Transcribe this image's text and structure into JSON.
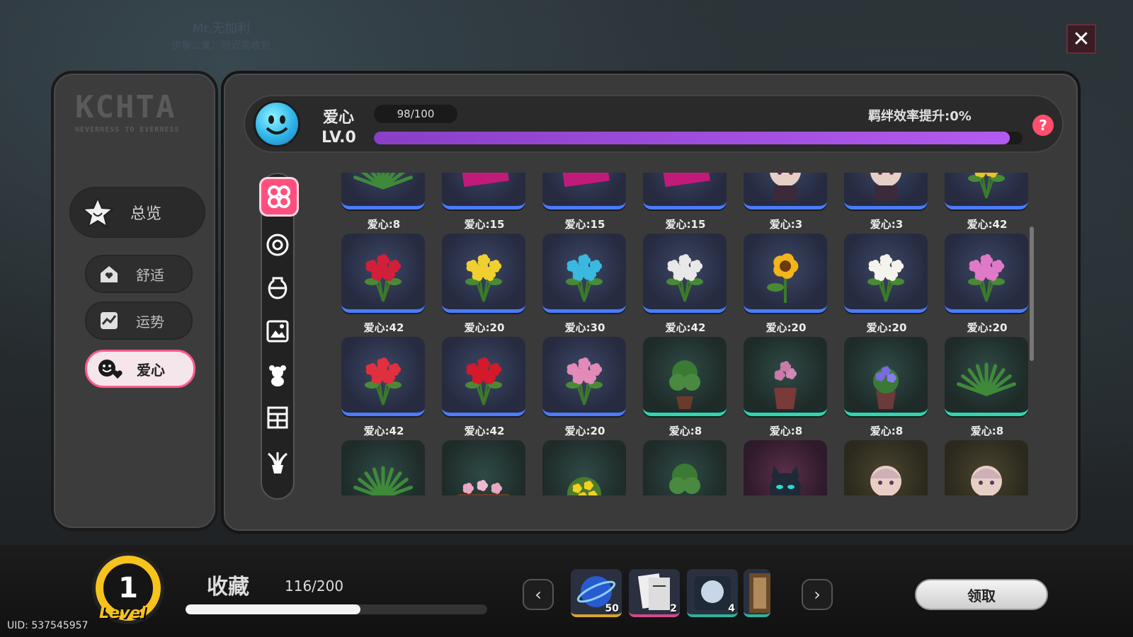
{
  "background": {
    "text1": "Mr.无加利",
    "text2": "伊鲁公寓）附近家收到"
  },
  "close": {
    "icon": "close-x-icon",
    "symbol": "✕"
  },
  "left_panel": {
    "logo_big": "KCHTA",
    "logo_small": "NEVERNESS TO EVERNESS",
    "nav": [
      {
        "label": "总览",
        "icon": "star-icon"
      },
      {
        "label": "舒适",
        "icon": "house-heart-icon"
      },
      {
        "label": "运势",
        "icon": "trend-chart-icon"
      },
      {
        "label": "爱心",
        "icon": "smiley-heart-icon"
      }
    ]
  },
  "header": {
    "title": "爱心",
    "level": "LV.0",
    "count": "98/100",
    "progress": 0.98,
    "efficiency": "羁绊效率提升:0%",
    "help_symbol": "?"
  },
  "categories": [
    {
      "name": "all-category-icon",
      "active": true
    },
    {
      "name": "disc-category-icon",
      "active": false
    },
    {
      "name": "vase-category-icon",
      "active": false
    },
    {
      "name": "picture-category-icon",
      "active": false
    },
    {
      "name": "teddy-bear-category-icon",
      "active": false
    },
    {
      "name": "shelf-category-icon",
      "active": false
    },
    {
      "name": "plant-category-icon",
      "active": false
    }
  ],
  "items": [
    {
      "cost": "爱心:8",
      "kind": "palm",
      "frame": "blue"
    },
    {
      "cost": "爱心:15",
      "kind": "poster",
      "frame": "blue"
    },
    {
      "cost": "爱心:15",
      "kind": "poster",
      "frame": "blue"
    },
    {
      "cost": "爱心:15",
      "kind": "poster",
      "frame": "blue"
    },
    {
      "cost": "爱心:3",
      "kind": "doll",
      "frame": "blue"
    },
    {
      "cost": "爱心:3",
      "kind": "doll",
      "frame": "blue"
    },
    {
      "cost": "爱心:42",
      "kind": "yellowrose",
      "frame": "blue"
    },
    {
      "cost": "爱心:42",
      "kind": "redrose",
      "frame": "blue"
    },
    {
      "cost": "爱心:20",
      "kind": "yellowtulip",
      "frame": "blue"
    },
    {
      "cost": "爱心:30",
      "kind": "bluerose",
      "frame": "blue"
    },
    {
      "cost": "爱心:42",
      "kind": "whiterose",
      "frame": "blue"
    },
    {
      "cost": "爱心:20",
      "kind": "sunflower",
      "frame": "blue"
    },
    {
      "cost": "爱心:20",
      "kind": "whitelily",
      "frame": "blue"
    },
    {
      "cost": "爱心:20",
      "kind": "pinklily",
      "frame": "blue"
    },
    {
      "cost": "爱心:42",
      "kind": "redlily",
      "frame": "blue"
    },
    {
      "cost": "爱心:42",
      "kind": "redtulip",
      "frame": "blue"
    },
    {
      "cost": "爱心:20",
      "kind": "pinktulip",
      "frame": "blue"
    },
    {
      "cost": "爱心:8",
      "kind": "pottree",
      "frame": "green"
    },
    {
      "cost": "爱心:8",
      "kind": "potpink",
      "frame": "green"
    },
    {
      "cost": "爱心:8",
      "kind": "potpurple",
      "frame": "green"
    },
    {
      "cost": "爱心:8",
      "kind": "fern",
      "frame": "green"
    },
    {
      "cost": "",
      "kind": "palm",
      "frame": "green"
    },
    {
      "cost": "",
      "kind": "planter",
      "frame": "green"
    },
    {
      "cost": "",
      "kind": "yellowbush",
      "frame": "green"
    },
    {
      "cost": "",
      "kind": "pottree",
      "frame": "green"
    },
    {
      "cost": "",
      "kind": "catdoll",
      "frame": "pink"
    },
    {
      "cost": "",
      "kind": "doll",
      "frame": "yellow"
    },
    {
      "cost": "",
      "kind": "doll",
      "frame": "yellow"
    }
  ],
  "bottom": {
    "level_value": "1",
    "level_word": "Level",
    "uid": "UID:  537545957",
    "collect_label": "收藏",
    "collect_count": "116/200",
    "collect_progress": 0.58,
    "prev_symbol": "‹",
    "next_symbol": "›",
    "rewards": [
      {
        "qty": "50",
        "icon": "orb-reward-icon",
        "color": "#d9a52a"
      },
      {
        "qty": "2",
        "icon": "card-reward-icon",
        "color": "#d24a8a"
      },
      {
        "qty": "4",
        "icon": "disc-reward-icon",
        "color": "#2fb49a"
      },
      {
        "qty": "",
        "icon": "frame-reward-icon",
        "color": "#2fb49a"
      }
    ],
    "claim_label": "领取"
  }
}
